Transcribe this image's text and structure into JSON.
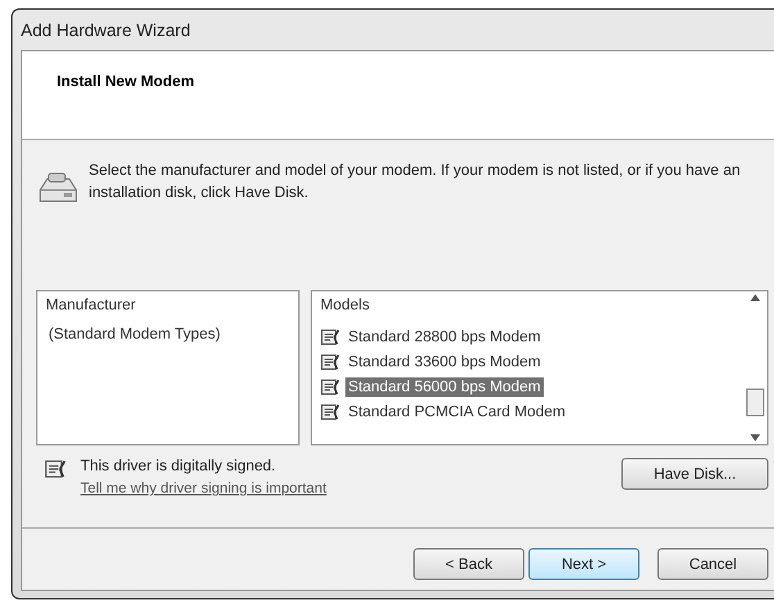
{
  "window": {
    "title": "Add Hardware Wizard"
  },
  "header": {
    "title": "Install New Modem"
  },
  "instruction": "Select the manufacturer and model of your modem. If your modem is not listed, or if you have an installation disk, click Have Disk.",
  "manufacturer_list": {
    "heading": "Manufacturer",
    "items": [
      {
        "label": "(Standard Modem Types)",
        "selected": false
      }
    ]
  },
  "models_list": {
    "heading": "Models",
    "items": [
      {
        "label": "Standard 28800 bps Modem",
        "selected": false
      },
      {
        "label": "Standard 33600 bps Modem",
        "selected": false
      },
      {
        "label": "Standard 56000 bps Modem",
        "selected": true
      },
      {
        "label": "Standard PCMCIA Card Modem",
        "selected": false
      }
    ]
  },
  "signing": {
    "text": "This driver is digitally signed.",
    "link": "Tell me why driver signing is important"
  },
  "have_disk_button": "Have Disk...",
  "buttons": [
    {
      "label": "< Back",
      "hovered": false
    },
    {
      "label": "Next >",
      "hovered": true
    },
    {
      "label": "Cancel",
      "hovered": false
    }
  ]
}
